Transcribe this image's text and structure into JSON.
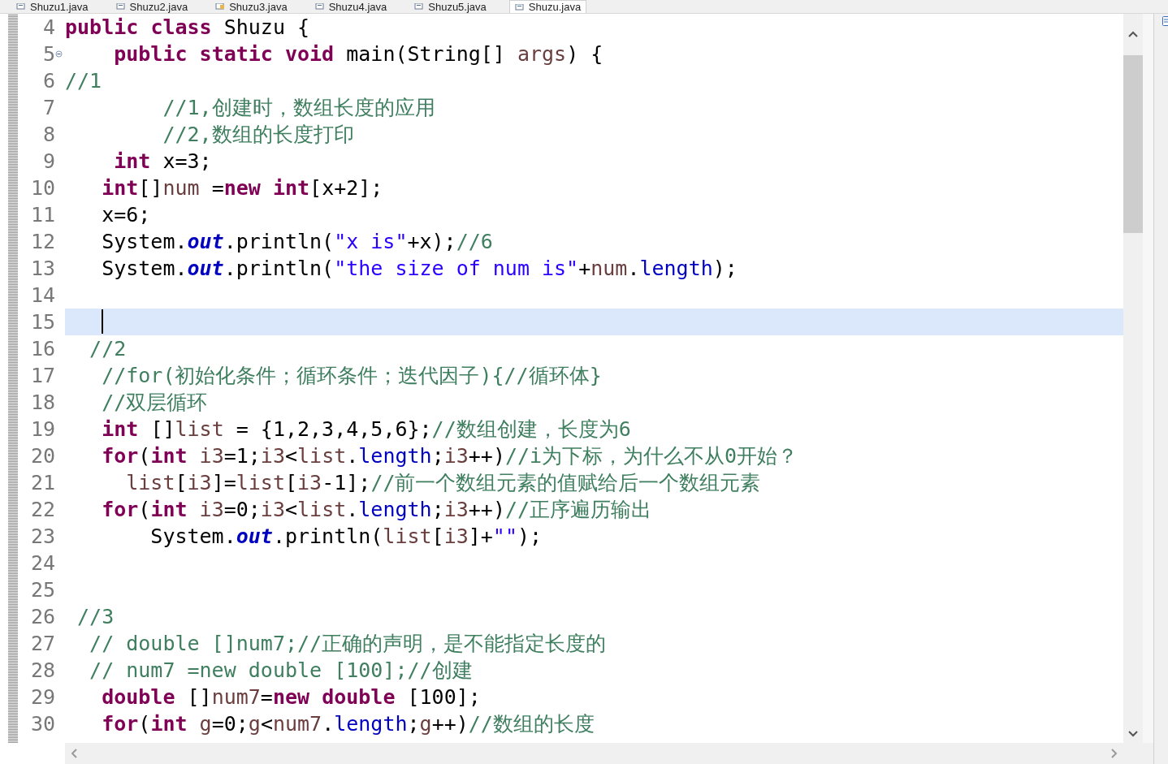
{
  "tabs": [
    {
      "label": "Shuzu1.java",
      "selected": false,
      "kind": "file"
    },
    {
      "label": "Shuzu2.java",
      "selected": false,
      "kind": "file"
    },
    {
      "label": "Shuzu3.java",
      "selected": false,
      "kind": "warning"
    },
    {
      "label": "Shuzu4.java",
      "selected": false,
      "kind": "file"
    },
    {
      "label": "Shuzu5.java",
      "selected": false,
      "kind": "file"
    },
    {
      "label": "Shuzu.java",
      "selected": true,
      "kind": "file"
    }
  ],
  "lines": [
    {
      "number": "4",
      "current": false,
      "fold_marker": false,
      "tokens": [
        {
          "kind": "keyword",
          "text": "public"
        },
        {
          "kind": "keyword",
          "text": " class"
        },
        {
          "kind": "plain",
          "text": " Shuzu {"
        }
      ]
    },
    {
      "number": "5",
      "current": false,
      "fold_marker": true,
      "tokens": [
        {
          "kind": "keyword",
          "text": "    public"
        },
        {
          "kind": "keyword",
          "text": " static"
        },
        {
          "kind": "keyword",
          "text": " void"
        },
        {
          "kind": "plain",
          "text": " main(String[] "
        },
        {
          "kind": "var",
          "text": "args"
        },
        {
          "kind": "plain",
          "text": ") {"
        }
      ]
    },
    {
      "number": "6",
      "current": false,
      "fold_marker": false,
      "tokens": [
        {
          "kind": "comment",
          "text": "//1"
        }
      ]
    },
    {
      "number": "7",
      "current": false,
      "fold_marker": false,
      "tokens": [
        {
          "kind": "comment",
          "text": "        //1,创建时，数组长度的应用"
        }
      ]
    },
    {
      "number": "8",
      "current": false,
      "fold_marker": false,
      "tokens": [
        {
          "kind": "comment",
          "text": "        //2,数组的长度打印"
        }
      ]
    },
    {
      "number": "9",
      "current": false,
      "fold_marker": false,
      "tokens": [
        {
          "kind": "keyword",
          "text": "    int"
        },
        {
          "kind": "plain",
          "text": " x=3;"
        }
      ]
    },
    {
      "number": "10",
      "current": false,
      "fold_marker": false,
      "tokens": [
        {
          "kind": "keyword",
          "text": "   int"
        },
        {
          "kind": "plain",
          "text": "[]"
        },
        {
          "kind": "var",
          "text": "num"
        },
        {
          "kind": "plain",
          "text": " ="
        },
        {
          "kind": "keyword",
          "text": "new"
        },
        {
          "kind": "keyword",
          "text": " int"
        },
        {
          "kind": "plain",
          "text": "[x+2];"
        }
      ]
    },
    {
      "number": "11",
      "current": false,
      "fold_marker": false,
      "tokens": [
        {
          "kind": "plain",
          "text": "   x=6;"
        }
      ]
    },
    {
      "number": "12",
      "current": false,
      "fold_marker": false,
      "tokens": [
        {
          "kind": "plain",
          "text": "   System."
        },
        {
          "kind": "static",
          "text": "out"
        },
        {
          "kind": "plain",
          "text": ".println("
        },
        {
          "kind": "string",
          "text": "\"x is\""
        },
        {
          "kind": "plain",
          "text": "+x);"
        },
        {
          "kind": "comment",
          "text": "//6"
        }
      ]
    },
    {
      "number": "13",
      "current": false,
      "fold_marker": false,
      "tokens": [
        {
          "kind": "plain",
          "text": "   System."
        },
        {
          "kind": "static",
          "text": "out"
        },
        {
          "kind": "plain",
          "text": ".println("
        },
        {
          "kind": "string",
          "text": "\"the size of num is\""
        },
        {
          "kind": "plain",
          "text": "+"
        },
        {
          "kind": "var",
          "text": "num"
        },
        {
          "kind": "plain",
          "text": "."
        },
        {
          "kind": "field",
          "text": "length"
        },
        {
          "kind": "plain",
          "text": ");"
        }
      ]
    },
    {
      "number": "14",
      "current": false,
      "fold_marker": false
    },
    {
      "number": "15",
      "current": true,
      "fold_marker": false
    },
    {
      "number": "16",
      "current": false,
      "fold_marker": false,
      "tokens": [
        {
          "kind": "comment",
          "text": "  //2"
        }
      ]
    },
    {
      "number": "17",
      "current": false,
      "fold_marker": false,
      "tokens": [
        {
          "kind": "comment",
          "text": "   //for(初始化条件；循环条件；迭代因子){//循环体}"
        }
      ]
    },
    {
      "number": "18",
      "current": false,
      "fold_marker": false,
      "tokens": [
        {
          "kind": "comment",
          "text": "   //双层循环"
        }
      ]
    },
    {
      "number": "19",
      "current": false,
      "fold_marker": false,
      "tokens": [
        {
          "kind": "keyword",
          "text": "   int"
        },
        {
          "kind": "plain",
          "text": " []"
        },
        {
          "kind": "var",
          "text": "list"
        },
        {
          "kind": "plain",
          "text": " = {1,2,3,4,5,6};"
        },
        {
          "kind": "comment",
          "text": "//数组创建，长度为6"
        }
      ]
    },
    {
      "number": "20",
      "current": false,
      "fold_marker": false,
      "tokens": [
        {
          "kind": "keyword",
          "text": "   for"
        },
        {
          "kind": "plain",
          "text": "("
        },
        {
          "kind": "keyword",
          "text": "int"
        },
        {
          "kind": "var",
          "text": " i3"
        },
        {
          "kind": "plain",
          "text": "=1;"
        },
        {
          "kind": "var",
          "text": "i3"
        },
        {
          "kind": "plain",
          "text": "<"
        },
        {
          "kind": "var",
          "text": "list"
        },
        {
          "kind": "plain",
          "text": "."
        },
        {
          "kind": "field",
          "text": "length"
        },
        {
          "kind": "plain",
          "text": ";"
        },
        {
          "kind": "var",
          "text": "i3"
        },
        {
          "kind": "plain",
          "text": "++)"
        },
        {
          "kind": "comment",
          "text": "//i为下标，为什么不从0开始？"
        }
      ]
    },
    {
      "number": "21",
      "current": false,
      "fold_marker": false,
      "tokens": [
        {
          "kind": "var",
          "text": "     list"
        },
        {
          "kind": "plain",
          "text": "["
        },
        {
          "kind": "var",
          "text": "i3"
        },
        {
          "kind": "plain",
          "text": "]="
        },
        {
          "kind": "var",
          "text": "list"
        },
        {
          "kind": "plain",
          "text": "["
        },
        {
          "kind": "var",
          "text": "i3"
        },
        {
          "kind": "plain",
          "text": "-1];"
        },
        {
          "kind": "comment",
          "text": "//前一个数组元素的值赋给后一个数组元素"
        }
      ]
    },
    {
      "number": "22",
      "current": false,
      "fold_marker": false,
      "tokens": [
        {
          "kind": "keyword",
          "text": "   for"
        },
        {
          "kind": "plain",
          "text": "("
        },
        {
          "kind": "keyword",
          "text": "int"
        },
        {
          "kind": "var",
          "text": " i3"
        },
        {
          "kind": "plain",
          "text": "=0;"
        },
        {
          "kind": "var",
          "text": "i3"
        },
        {
          "kind": "plain",
          "text": "<"
        },
        {
          "kind": "var",
          "text": "list"
        },
        {
          "kind": "plain",
          "text": "."
        },
        {
          "kind": "field",
          "text": "length"
        },
        {
          "kind": "plain",
          "text": ";"
        },
        {
          "kind": "var",
          "text": "i3"
        },
        {
          "kind": "plain",
          "text": "++)"
        },
        {
          "kind": "comment",
          "text": "//正序遍历输出"
        }
      ]
    },
    {
      "number": "23",
      "current": false,
      "fold_marker": false,
      "tokens": [
        {
          "kind": "plain",
          "text": "       System."
        },
        {
          "kind": "static",
          "text": "out"
        },
        {
          "kind": "plain",
          "text": ".println("
        },
        {
          "kind": "var",
          "text": "list"
        },
        {
          "kind": "plain",
          "text": "["
        },
        {
          "kind": "var",
          "text": "i3"
        },
        {
          "kind": "plain",
          "text": "]+"
        },
        {
          "kind": "string",
          "text": "\"\""
        },
        {
          "kind": "plain",
          "text": ");"
        }
      ]
    },
    {
      "number": "24",
      "current": false,
      "fold_marker": false
    },
    {
      "number": "25",
      "current": false,
      "fold_marker": false
    },
    {
      "number": "26",
      "current": false,
      "fold_marker": false,
      "tokens": [
        {
          "kind": "comment",
          "text": " //3"
        }
      ]
    },
    {
      "number": "27",
      "current": false,
      "fold_marker": false,
      "tokens": [
        {
          "kind": "comment",
          "text": "  // double []num7;//正确的声明，是不能指定长度的"
        }
      ]
    },
    {
      "number": "28",
      "current": false,
      "fold_marker": false,
      "tokens": [
        {
          "kind": "comment",
          "text": "  // num7 =new double [100];//创建"
        }
      ]
    },
    {
      "number": "29",
      "current": false,
      "fold_marker": false,
      "tokens": [
        {
          "kind": "keyword",
          "text": "   double"
        },
        {
          "kind": "plain",
          "text": " []"
        },
        {
          "kind": "var",
          "text": "num7"
        },
        {
          "kind": "plain",
          "text": "="
        },
        {
          "kind": "keyword",
          "text": "new"
        },
        {
          "kind": "keyword",
          "text": " double"
        },
        {
          "kind": "plain",
          "text": " [100];"
        }
      ]
    },
    {
      "number": "30",
      "current": false,
      "fold_marker": false,
      "tokens": [
        {
          "kind": "keyword",
          "text": "   for"
        },
        {
          "kind": "plain",
          "text": "("
        },
        {
          "kind": "keyword",
          "text": "int"
        },
        {
          "kind": "var",
          "text": " g"
        },
        {
          "kind": "plain",
          "text": "=0;"
        },
        {
          "kind": "var",
          "text": "g"
        },
        {
          "kind": "plain",
          "text": "<"
        },
        {
          "kind": "var",
          "text": "num7"
        },
        {
          "kind": "plain",
          "text": "."
        },
        {
          "kind": "field",
          "text": "length"
        },
        {
          "kind": "plain",
          "text": ";"
        },
        {
          "kind": "var",
          "text": "g"
        },
        {
          "kind": "plain",
          "text": "++)"
        },
        {
          "kind": "comment",
          "text": "//数组的长度"
        }
      ]
    }
  ]
}
